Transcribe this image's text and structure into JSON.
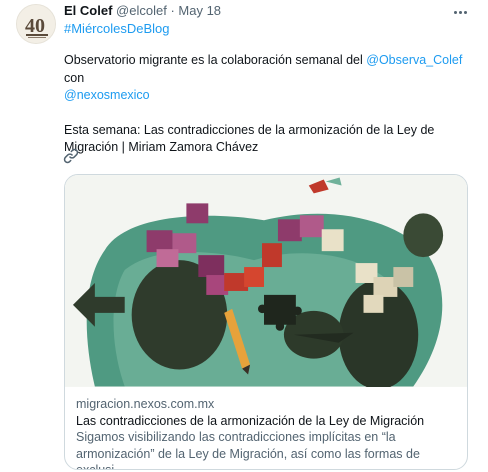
{
  "tweet": {
    "author_name": "El Colef",
    "author_handle": "@elcolef",
    "separator": "·",
    "date": "May 18",
    "hashtag": "#MiércolesDeBlog",
    "avatar_text": "40",
    "text_part1": "Observatorio migrante es la colaboración semanal del ",
    "mention1": "@Observa_Colef",
    "text_part2": " con",
    "mention2": "@nexosmexico",
    "line3": "Esta semana: Las contradicciones de la armonización de la Ley de Migración | Miriam Zamora Chávez"
  },
  "card": {
    "domain": "migracion.nexos.com.mx",
    "title": "Las contradicciones de la armonización de la Ley de Migración",
    "description_line1": "Sigamos visibilizando las contradicciones implícitas en “la",
    "description_line2": "armonización” de la Ley de Migración, así como las formas de exclusi..."
  },
  "colors": {
    "link": "#1d9bf0",
    "secondary_text": "#536471",
    "border": "#cfd9de"
  },
  "icons": [
    "more-icon",
    "link-icon"
  ]
}
